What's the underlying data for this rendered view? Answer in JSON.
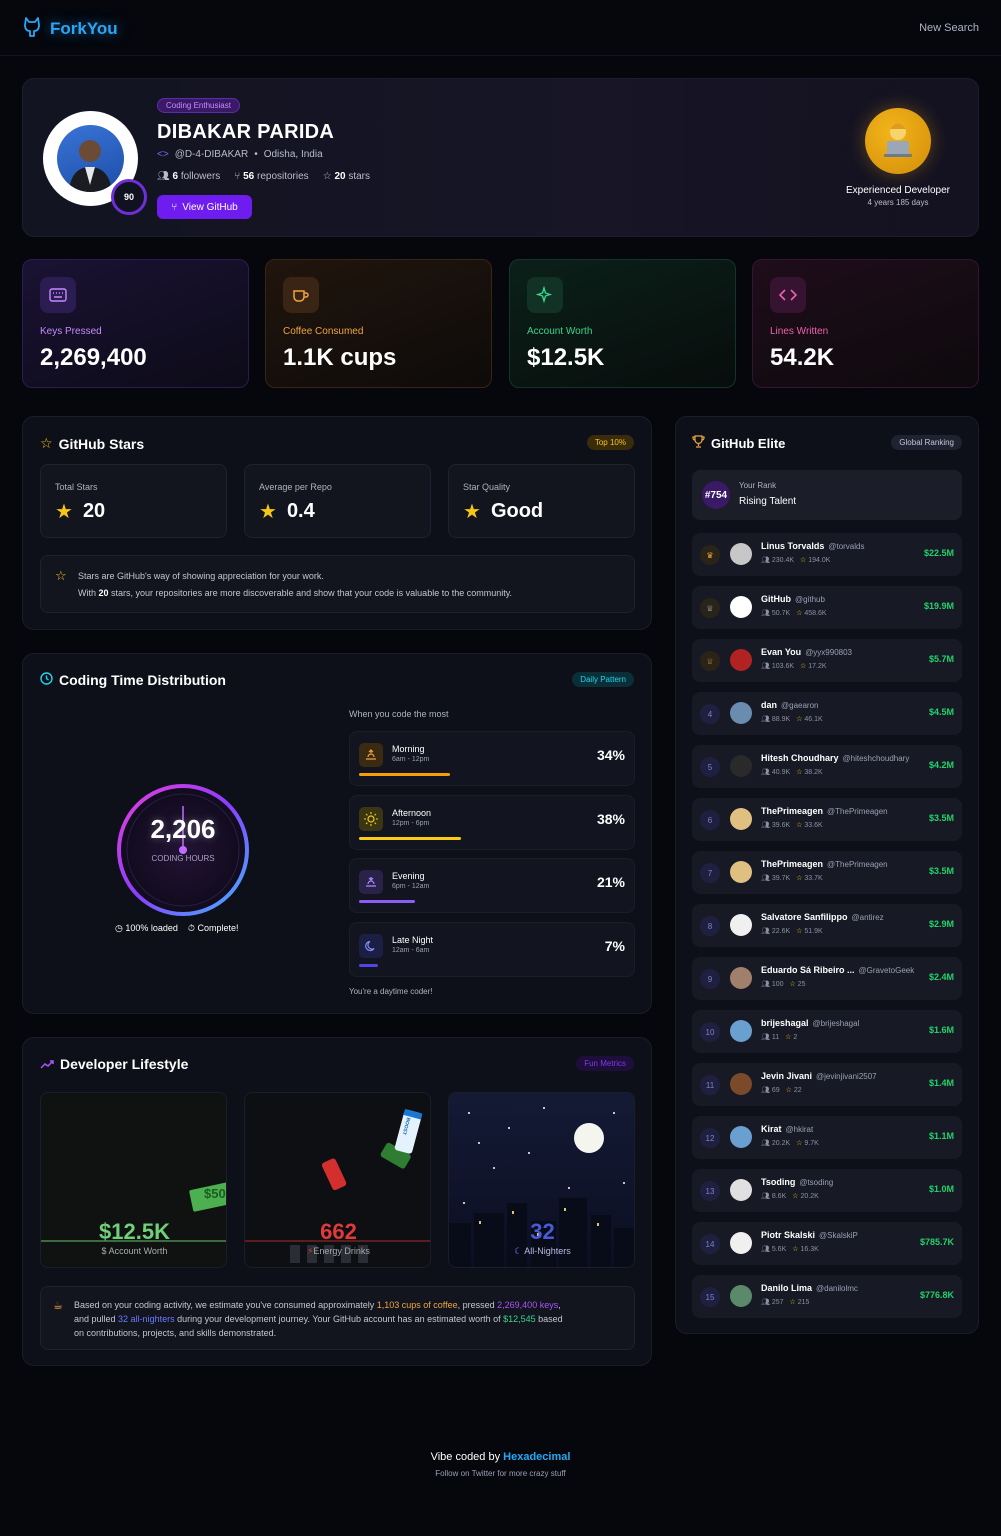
{
  "header": {
    "app_name": "ForkYou",
    "new_search_label": "New Search"
  },
  "profile": {
    "badge": "Coding Enthusiast",
    "name": "DIBAKAR PARIDA",
    "handle": "@D-4-DIBAKAR",
    "location": "Odisha, India",
    "score": "90",
    "followers_count": "6",
    "followers_label": "followers",
    "repos_count": "56",
    "repos_label": "repositories",
    "stars_count": "20",
    "stars_label": "stars",
    "view_button": "View GitHub",
    "experience_title": "Experienced Developer",
    "experience_duration": "4 years 185 days"
  },
  "metrics": [
    {
      "label": "Keys Pressed",
      "value": "2,269,400",
      "color": "#c48cff"
    },
    {
      "label": "Coffee Consumed",
      "value": "1.1K cups",
      "color": "#f0a540"
    },
    {
      "label": "Account Worth",
      "value": "$12.5K",
      "color": "#37d68a"
    },
    {
      "label": "Lines Written",
      "value": "54.2K",
      "color": "#f060b0"
    }
  ],
  "github_stars": {
    "title": "GitHub Stars",
    "badge": "Top 10%",
    "cards": [
      {
        "label": "Total Stars",
        "value": "20"
      },
      {
        "label": "Average per Repo",
        "value": "0.4"
      },
      {
        "label": "Star Quality",
        "value": "Good"
      }
    ],
    "note_line1": "Stars are GitHub's way of showing appreciation for your work.",
    "note_line2_pre": "With ",
    "note_line2_bold": "20",
    "note_line2_post": " stars, your repositories are more discoverable and show that your code is valuable to the community."
  },
  "coding_time": {
    "title": "Coding Time Distribution",
    "badge": "Daily Pattern",
    "hours": "2,206",
    "hours_label": "CODING HOURS",
    "loaded": "100% loaded",
    "complete": "Complete!",
    "subtitle": "When you code the most",
    "rows": [
      {
        "name": "Morning",
        "range": "6am - 12pm",
        "pct": "34%",
        "fraction": 0.34,
        "color": "#f59e0b"
      },
      {
        "name": "Afternoon",
        "range": "12pm - 6pm",
        "pct": "38%",
        "fraction": 0.38,
        "color": "#facc15"
      },
      {
        "name": "Evening",
        "range": "6pm - 12am",
        "pct": "21%",
        "fraction": 0.21,
        "color": "#8b5cf6"
      },
      {
        "name": "Late Night",
        "range": "12am - 6am",
        "pct": "7%",
        "fraction": 0.07,
        "color": "#4f46e5"
      }
    ],
    "footer": "You're a daytime coder!"
  },
  "lifestyle": {
    "title": "Developer Lifestyle",
    "badge": "Fun Metrics",
    "tiles": [
      {
        "value": "$12.5K",
        "label": "Account Worth",
        "color": "#6fcf7a"
      },
      {
        "value": "662",
        "label": "Energy Drinks",
        "color": "#e03a3a"
      },
      {
        "value": "32",
        "label": "All-Nighters",
        "color": "#4a5ad6"
      }
    ],
    "money_tag": "$50",
    "boost_tag": "BOOST",
    "summary_1": "Based on your coding activity, we estimate you've consumed approximately ",
    "summary_coffee": "1,103 cups of coffee",
    "summary_2": ", pressed ",
    "summary_keys": "2,269,400 keys",
    "summary_3": ",",
    "summary_4": "and pulled ",
    "summary_nights": "32 all-nighters",
    "summary_5": " during your development journey. Your GitHub account has an estimated worth of ",
    "summary_worth": "$12,545",
    "summary_6": " based",
    "summary_7": "on contributions, projects, and skills demonstrated."
  },
  "elite": {
    "title": "GitHub Elite",
    "badge": "Global Ranking",
    "rank": "#754",
    "rank_label": "Your Rank",
    "rank_title": "Rising Talent",
    "leaders": [
      {
        "rank": "1",
        "name": "Linus Torvalds",
        "user": "@torvalds",
        "followers": "230.4K",
        "stars": "194.0K",
        "worth": "$22.5M",
        "medal": "#f0a540"
      },
      {
        "rank": "2",
        "name": "GitHub",
        "user": "@github",
        "followers": "50.7K",
        "stars": "458.6K",
        "worth": "$19.9M",
        "medal": "#b8bccb"
      },
      {
        "rank": "3",
        "name": "Evan You",
        "user": "@yyx990803",
        "followers": "103.6K",
        "stars": "17.2K",
        "worth": "$5.7M",
        "medal": "#d9792b"
      },
      {
        "rank": "4",
        "name": "dan",
        "user": "@gaearon",
        "followers": "88.9K",
        "stars": "46.1K",
        "worth": "$4.5M"
      },
      {
        "rank": "5",
        "name": "Hitesh Choudhary",
        "user": "@hiteshchoudhary",
        "followers": "40.9K",
        "stars": "38.2K",
        "worth": "$4.2M"
      },
      {
        "rank": "6",
        "name": "ThePrimeagen",
        "user": "@ThePrimeagen",
        "followers": "39.6K",
        "stars": "33.6K",
        "worth": "$3.5M"
      },
      {
        "rank": "7",
        "name": "ThePrimeagen",
        "user": "@ThePrimeagen",
        "followers": "39.7K",
        "stars": "33.7K",
        "worth": "$3.5M"
      },
      {
        "rank": "8",
        "name": "Salvatore Sanfilippo",
        "user": "@antirez",
        "followers": "22.6K",
        "stars": "51.9K",
        "worth": "$2.9M"
      },
      {
        "rank": "9",
        "name": "Eduardo Sá Ribeiro ...",
        "user": "@GravetoGeek",
        "followers": "100",
        "stars": "25",
        "worth": "$2.4M"
      },
      {
        "rank": "10",
        "name": "brijeshagal",
        "user": "@brijeshagal",
        "followers": "11",
        "stars": "2",
        "worth": "$1.6M"
      },
      {
        "rank": "11",
        "name": "Jevin Jivani",
        "user": "@jevinjivani2507",
        "followers": "69",
        "stars": "22",
        "worth": "$1.4M"
      },
      {
        "rank": "12",
        "name": "Kirat",
        "user": "@hkirat",
        "followers": "20.2K",
        "stars": "9.7K",
        "worth": "$1.1M"
      },
      {
        "rank": "13",
        "name": "Tsoding",
        "user": "@tsoding",
        "followers": "8.6K",
        "stars": "20.2K",
        "worth": "$1.0M"
      },
      {
        "rank": "14",
        "name": "Piotr Skalski",
        "user": "@SkalskiP",
        "followers": "5.6K",
        "stars": "16.3K",
        "worth": "$785.7K"
      },
      {
        "rank": "15",
        "name": "Danilo Lima",
        "user": "@danilolmc",
        "followers": "257",
        "stars": "215",
        "worth": "$776.8K"
      }
    ]
  },
  "footer": {
    "credit_pre": "Vibe coded by ",
    "credit_name": "Hexadecimal",
    "follow": "Follow on Twitter for more crazy stuff"
  }
}
